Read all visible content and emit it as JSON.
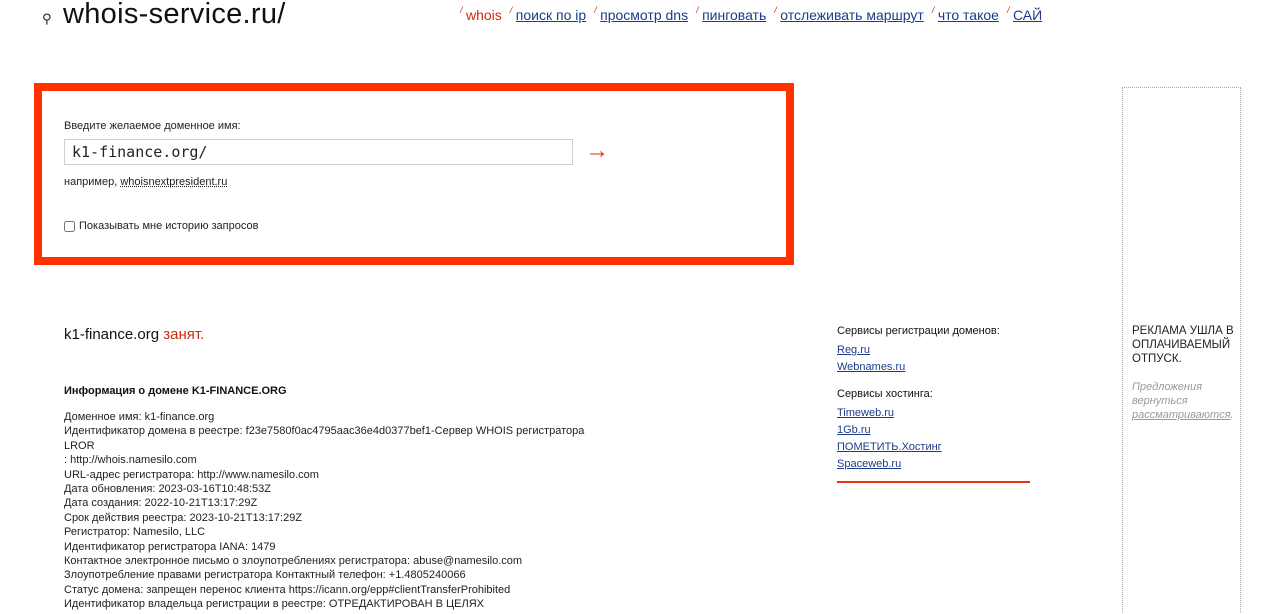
{
  "header": {
    "logo_icon": "⚲",
    "site_title": "whois-service.ru/",
    "nav": [
      {
        "label": "whois",
        "active": true
      },
      {
        "label": "поиск по ip",
        "active": false
      },
      {
        "label": "просмотр dns",
        "active": false
      },
      {
        "label": "пинговать",
        "active": false
      },
      {
        "label": "отслеживать маршрут",
        "active": false
      },
      {
        "label": "что такое",
        "active": false
      },
      {
        "label": "САЙ",
        "active": false
      }
    ]
  },
  "search": {
    "label": "Введите желаемое доменное имя:",
    "value": "k1-finance.org/",
    "arrow": "→",
    "example_prefix": "например,",
    "example_link": "whoisnextpresident.ru",
    "history_label": "Показывать мне историю запросов"
  },
  "result": {
    "domain": "k1-finance.org",
    "status": "занят.",
    "info_heading": "Информация о домене K1-FINANCE.ORG",
    "lines": [
      "Доменное имя: k1-finance.org",
      "Идентификатор домена в реестре: f23e7580f0ac4795aac36e4d0377bef1-Сервер WHOIS регистратора",
      "LROR",
      ": http://whois.namesilo.com",
      "URL-адрес регистратора: http://www.namesilo.com",
      "Дата обновления: 2023-03-16T10:48:53Z",
      "Дата создания: 2022-10-21T13:17:29Z",
      "Срок действия реестра: 2023-10-21T13:17:29Z",
      "Регистратор: Namesilo, LLC",
      "Идентификатор регистратора IANA: 1479",
      "Контактное электронное письмо о злоупотреблениях регистратора: abuse@namesilo.com",
      "Злоупотребление правами регистратора Контактный телефон: +1.4805240066",
      "Статус домена: запрещен перенос клиента https://icann.org/epp#clientTransferProhibited",
      "Идентификатор владельца регистрации в реестре: ОТРЕДАКТИРОВАН В ЦЕЛЯХ"
    ]
  },
  "services": {
    "registration_title": "Сервисы регистрации доменов:",
    "registration_links": [
      "Reg.ru",
      "Webnames.ru"
    ],
    "hosting_title": "Сервисы хостинга:",
    "hosting_links": [
      "Timeweb.ru",
      "1Gb.ru",
      "ПОМЕТИТЬ.Хостинг",
      "Spaceweb.ru"
    ]
  },
  "ad": {
    "title": "РЕКЛАМА УШЛА В ОПЛАЧИВАЕМЫЙ ОТПУСК.",
    "note_prefix": "Предложения вернуться",
    "note_link": "рассматриваются",
    "note_suffix": "."
  },
  "colors": {
    "accent": "#ff3300",
    "link": "#1d3b8a",
    "status": "#d02a0e"
  }
}
